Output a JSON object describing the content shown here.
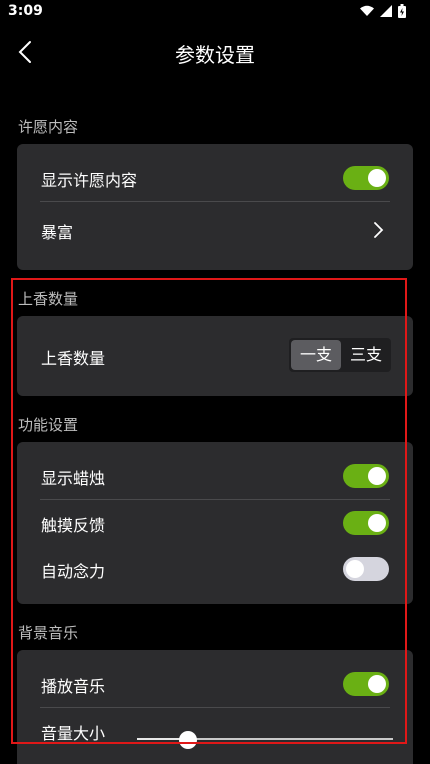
{
  "status_bar": {
    "time": "3:09"
  },
  "header": {
    "title": "参数设置"
  },
  "sections": {
    "wish": {
      "label": "许愿内容",
      "show_wish_label": "显示许愿内容",
      "show_wish_on": true,
      "wish_item_label": "暴富"
    },
    "incense": {
      "label": "上香数量",
      "row_label": "上香数量",
      "options": [
        "一支",
        "三支"
      ],
      "selected": "一支"
    },
    "features": {
      "label": "功能设置",
      "show_candle_label": "显示蜡烛",
      "show_candle_on": true,
      "haptic_label": "触摸反馈",
      "haptic_on": true,
      "auto_chant_label": "自动念力",
      "auto_chant_on": false
    },
    "music": {
      "label": "背景音乐",
      "play_music_label": "播放音乐",
      "play_music_on": true,
      "volume_label": "音量大小",
      "volume_fraction": 0.2
    }
  },
  "colors": {
    "toggle_on": "#6ab014",
    "toggle_off": "#d5d5de",
    "highlight": "#e01818"
  },
  "icons": [
    "wifi-icon",
    "signal-icon",
    "battery-icon",
    "back-arrow-icon",
    "chevron-right-icon"
  ]
}
